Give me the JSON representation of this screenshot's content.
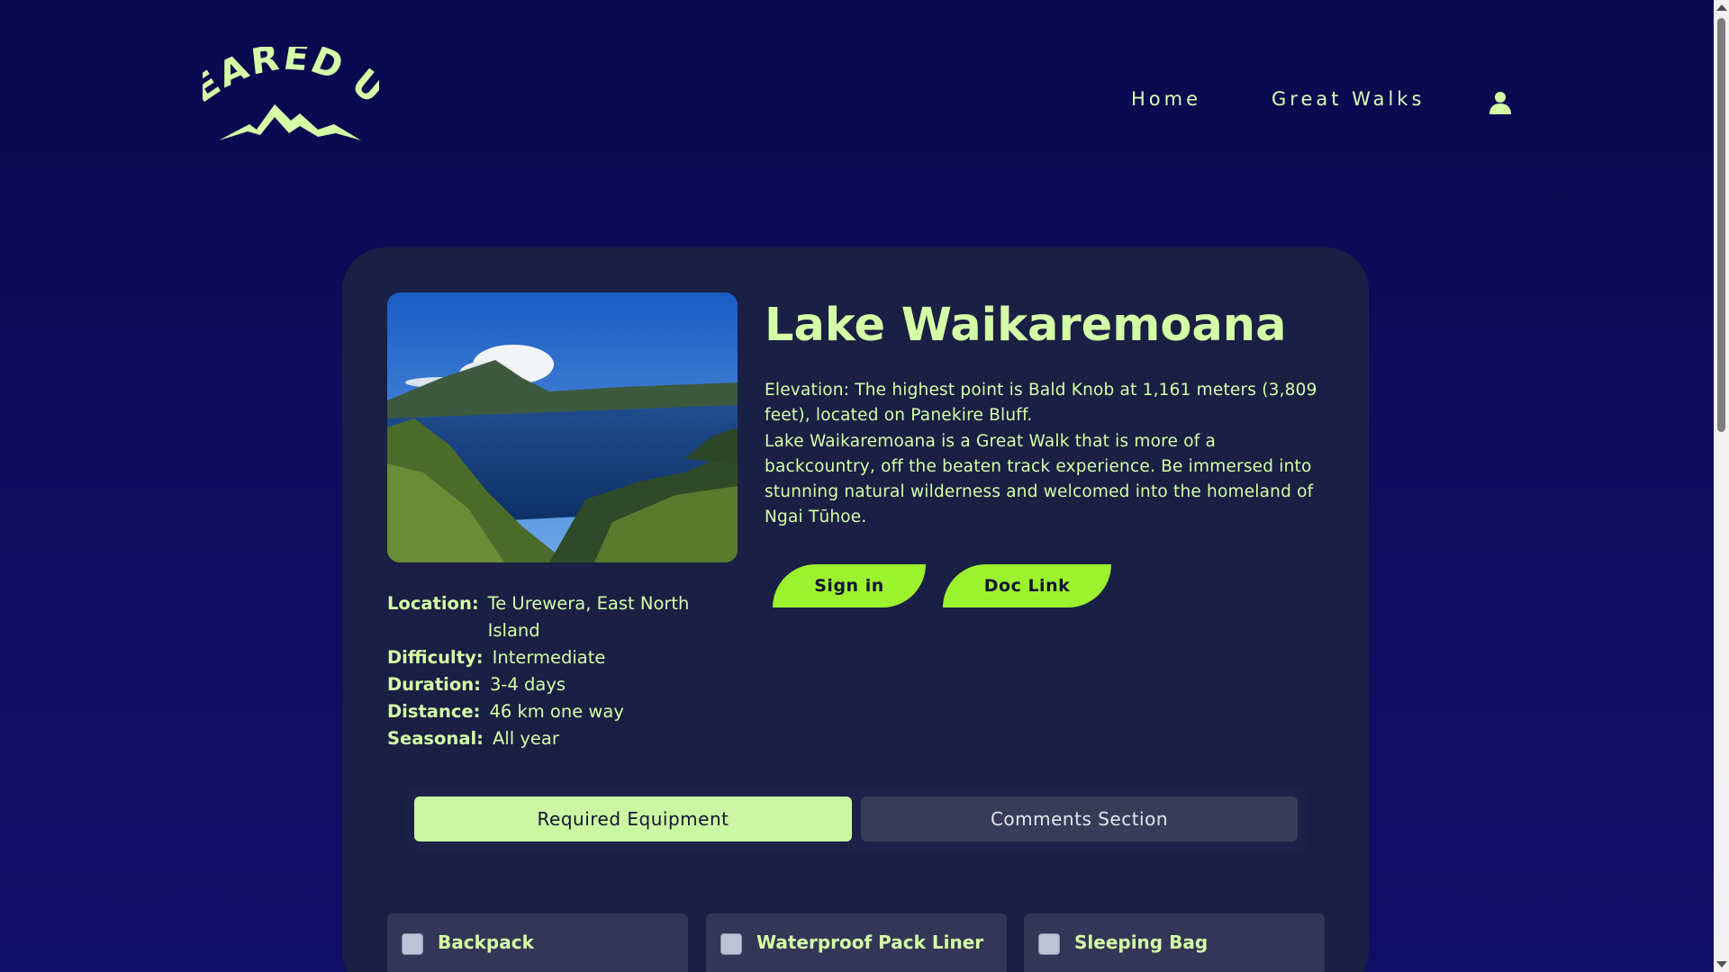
{
  "header": {
    "logo_text": "GEARED UP",
    "nav": [
      {
        "label": "Home"
      },
      {
        "label": "Great Walks"
      }
    ],
    "user_icon": "user-icon"
  },
  "walk": {
    "title": "Lake Waikaremoana",
    "description": [
      "Elevation: The highest point is Bald Knob at 1,161 meters (3,809 feet), located on Panekire Bluff.",
      "Lake Waikaremoana is a Great Walk that is more of a backcountry, off the beaten track experience. Be immersed into stunning natural wilderness and welcomed into the homeland of Ngai Tūhoe."
    ],
    "buttons": {
      "sign_in": "Sign in",
      "doc_link": "Doc Link"
    },
    "details": [
      {
        "key": "Location:",
        "value": "Te Urewera, East North Island"
      },
      {
        "key": "Difficulty:",
        "value": "Intermediate"
      },
      {
        "key": "Duration:",
        "value": "3-4 days"
      },
      {
        "key": "Distance:",
        "value": "46 km one way"
      },
      {
        "key": "Seasonal:",
        "value": "All year"
      }
    ]
  },
  "tabs": [
    {
      "label": "Required Equipment",
      "active": true
    },
    {
      "label": "Comments Section",
      "active": false
    }
  ],
  "equipment": [
    {
      "label": "Backpack",
      "checked": false
    },
    {
      "label": "Waterproof Pack Liner",
      "checked": false
    },
    {
      "label": "Sleeping Bag",
      "checked": false
    }
  ],
  "colors": {
    "background": "#0b0a52",
    "card": "#1a1f44",
    "accent_text": "#d5ffa6",
    "button": "#9cf22e",
    "tab_active": "#ccf7a2",
    "tab_inactive": "#363d57"
  }
}
